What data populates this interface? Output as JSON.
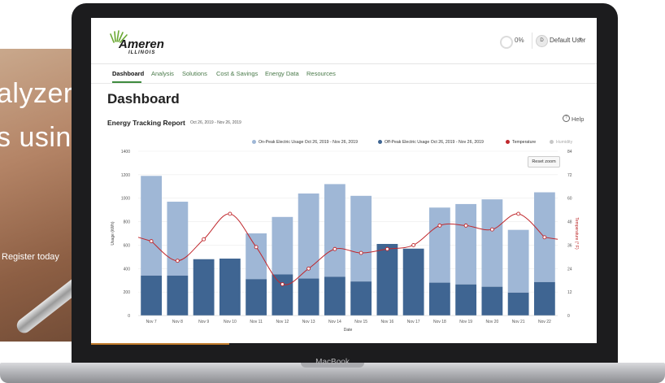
{
  "background": {
    "headline_line1": "alyzer",
    "headline_line2": "s usin",
    "register_text": "Register today"
  },
  "laptop": {
    "brand": "MacBook"
  },
  "header": {
    "logo_word": "Ameren",
    "logo_sub": "ILLINOIS",
    "progress": "0%",
    "avatar_initial": "D",
    "user_name": "Default User"
  },
  "nav": {
    "items": [
      "Dashboard",
      "Analysis",
      "Solutions",
      "Cost & Savings",
      "Energy Data",
      "Resources"
    ],
    "active": "Dashboard",
    "help": "Help"
  },
  "page": {
    "title": "Dashboard",
    "report_title": "Energy Tracking Report",
    "report_range": "Oct 26, 2019 - Nov 26, 2019",
    "reset_zoom": "Reset zoom"
  },
  "colors": {
    "on_peak": "#9fb7d6",
    "off_peak": "#3f6592",
    "temperature": "#c0282d",
    "humidity": "#c8c8c8",
    "accent_green": "#3f8c3f"
  },
  "chart_data": {
    "type": "bar",
    "categories": [
      "Nov 7",
      "Nov 8",
      "Nov 9",
      "Nov 10",
      "Nov 11",
      "Nov 12",
      "Nov 13",
      "Nov 14",
      "Nov 15",
      "Nov 16",
      "Nov 17",
      "Nov 18",
      "Nov 19",
      "Nov 20",
      "Nov 21",
      "Nov 22"
    ],
    "series": [
      {
        "name": "On-Peak Electric Usage Oct 26, 2019 - Nov 26, 2019",
        "stack_total": [
          1190,
          970,
          0,
          0,
          700,
          840,
          1040,
          1120,
          1020,
          0,
          0,
          920,
          950,
          990,
          730,
          1050
        ]
      },
      {
        "name": "Off-Peak Electric Usage Oct 26, 2019 - Nov 26, 2019",
        "values": [
          340,
          340,
          480,
          485,
          310,
          350,
          315,
          330,
          290,
          610,
          570,
          280,
          265,
          245,
          195,
          285
        ]
      },
      {
        "name": "Temperature",
        "values": [
          38,
          28,
          39,
          52,
          35,
          16,
          24,
          34,
          32,
          34,
          36,
          46,
          46,
          44,
          52,
          40
        ]
      },
      {
        "name": "Humidity",
        "values": []
      }
    ],
    "y_left": {
      "label": "Usage (kWh)",
      "range": [
        0,
        1400
      ],
      "ticks": [
        "0",
        "200",
        "400",
        "600",
        "800",
        "1000",
        "1200",
        "1400"
      ]
    },
    "y_right": {
      "label": "Temperature (° F)",
      "range": [
        0,
        84
      ],
      "ticks": [
        "0",
        "12",
        "24",
        "36",
        "48",
        "60",
        "72",
        "84"
      ]
    },
    "xlabel": "Date",
    "legend_position": "top-right"
  }
}
